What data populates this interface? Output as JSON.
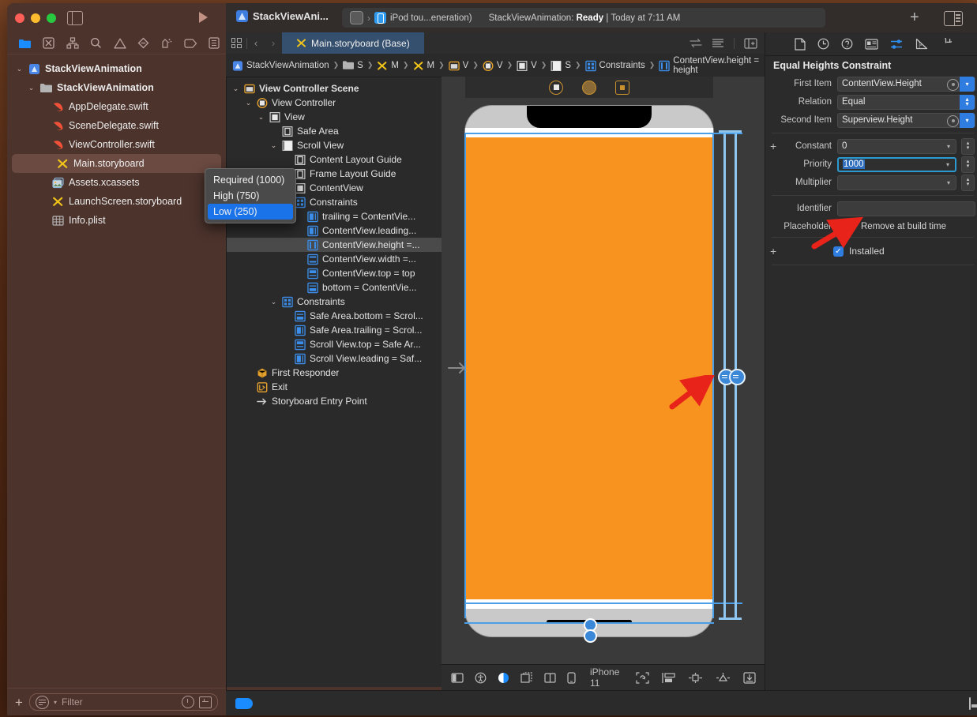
{
  "window": {
    "title": "StackViewAni...",
    "status": {
      "prefix": "StackViewAnimation:",
      "state": "Ready",
      "sep": "|",
      "time": "Today at 7:11 AM"
    },
    "device": "iPod tou...eneration)",
    "plus_label": "+"
  },
  "navigator": {
    "tabs": [
      {
        "name": "folder-icon"
      },
      {
        "name": "source-control-icon"
      },
      {
        "name": "symbol-hierarchy-icon"
      },
      {
        "name": "search-icon"
      },
      {
        "name": "issue-warning-icon"
      },
      {
        "name": "test-diamond-icon"
      },
      {
        "name": "debug-spray-icon"
      },
      {
        "name": "breakpoint-icon"
      },
      {
        "name": "report-icon"
      }
    ],
    "items": [
      {
        "label": "StackViewAnimation",
        "icon": "project-icon",
        "depth": 0,
        "disclosure": "v",
        "selected": false
      },
      {
        "label": "StackViewAnimation",
        "icon": "folder-icon",
        "depth": 1,
        "disclosure": "v",
        "selected": false
      },
      {
        "label": "AppDelegate.swift",
        "icon": "swift-icon",
        "depth": 2,
        "disclosure": "",
        "selected": false
      },
      {
        "label": "SceneDelegate.swift",
        "icon": "swift-icon",
        "depth": 2,
        "disclosure": "",
        "selected": false
      },
      {
        "label": "ViewController.swift",
        "icon": "swift-icon",
        "depth": 2,
        "disclosure": "",
        "selected": false
      },
      {
        "label": "Main.storyboard",
        "icon": "storyboard-icon",
        "depth": 2,
        "disclosure": "",
        "selected": true
      },
      {
        "label": "Assets.xcassets",
        "icon": "assets-icon",
        "depth": 2,
        "disclosure": "",
        "selected": false
      },
      {
        "label": "LaunchScreen.storyboard",
        "icon": "storyboard-icon",
        "depth": 2,
        "disclosure": "",
        "selected": false
      },
      {
        "label": "Info.plist",
        "icon": "plist-icon",
        "depth": 2,
        "disclosure": "",
        "selected": false
      }
    ],
    "filter_placeholder": "Filter"
  },
  "outline": {
    "items": [
      {
        "label": "View Controller Scene",
        "icon": "scene-icon",
        "depth": 0,
        "disclosure": "v",
        "selected": false,
        "bold": true
      },
      {
        "label": "View Controller",
        "icon": "viewcontroller-icon",
        "depth": 1,
        "disclosure": "v",
        "selected": false
      },
      {
        "label": "View",
        "icon": "view-icon",
        "depth": 2,
        "disclosure": "v",
        "selected": false
      },
      {
        "label": "Safe Area",
        "icon": "guide-icon",
        "depth": 3,
        "disclosure": "",
        "selected": false
      },
      {
        "label": "Scroll View",
        "icon": "scrollview-icon",
        "depth": 3,
        "disclosure": "v",
        "selected": false
      },
      {
        "label": "Content Layout Guide",
        "icon": "guide-icon",
        "depth": 4,
        "disclosure": "",
        "selected": false
      },
      {
        "label": "Frame Layout Guide",
        "icon": "guide-icon",
        "depth": 4,
        "disclosure": "",
        "selected": false
      },
      {
        "label": "ContentView",
        "icon": "view-icon",
        "depth": 4,
        "disclosure": "",
        "selected": false
      },
      {
        "label": "Constraints",
        "icon": "constraints-icon",
        "depth": 4,
        "disclosure": "v",
        "selected": false
      },
      {
        "label": "trailing = ContentVie...",
        "icon": "constraint-h-icon",
        "depth": 5,
        "disclosure": "",
        "selected": false
      },
      {
        "label": "ContentView.leading...",
        "icon": "constraint-h-icon",
        "depth": 5,
        "disclosure": "",
        "selected": false
      },
      {
        "label": "ContentView.height =...",
        "icon": "constraint-w-icon",
        "depth": 5,
        "disclosure": "",
        "selected": true
      },
      {
        "label": "ContentView.width =...",
        "icon": "constraint-v-icon",
        "depth": 5,
        "disclosure": "",
        "selected": false
      },
      {
        "label": "ContentView.top = top",
        "icon": "constraint-t-icon",
        "depth": 5,
        "disclosure": "",
        "selected": false
      },
      {
        "label": "bottom = ContentVie...",
        "icon": "constraint-b-icon",
        "depth": 5,
        "disclosure": "",
        "selected": false
      },
      {
        "label": "Constraints",
        "icon": "constraints-icon",
        "depth": 3,
        "disclosure": "v",
        "selected": false
      },
      {
        "label": "Safe Area.bottom = Scrol...",
        "icon": "constraint-b-icon",
        "depth": 4,
        "disclosure": "",
        "selected": false
      },
      {
        "label": "Safe Area.trailing = Scrol...",
        "icon": "constraint-h-icon",
        "depth": 4,
        "disclosure": "",
        "selected": false
      },
      {
        "label": "Scroll View.top = Safe Ar...",
        "icon": "constraint-t-icon",
        "depth": 4,
        "disclosure": "",
        "selected": false
      },
      {
        "label": "Scroll View.leading = Saf...",
        "icon": "constraint-h-icon",
        "depth": 4,
        "disclosure": "",
        "selected": false
      },
      {
        "label": "First Responder",
        "icon": "first-responder-icon",
        "depth": 1,
        "disclosure": "",
        "selected": false
      },
      {
        "label": "Exit",
        "icon": "exit-icon",
        "depth": 1,
        "disclosure": "",
        "selected": false
      },
      {
        "label": "Storyboard Entry Point",
        "icon": "entry-point-icon",
        "depth": 1,
        "disclosure": "",
        "selected": false
      }
    ],
    "filter_placeholder": "Filter"
  },
  "editor": {
    "tab_label": "Main.storyboard (Base)",
    "breadcrumb": [
      {
        "label": "StackViewAnimation",
        "icon": "project-icon"
      },
      {
        "label": "S",
        "icon": "folder-icon"
      },
      {
        "label": "M",
        "icon": "storyboard-icon"
      },
      {
        "label": "M",
        "icon": "storyboard-icon"
      },
      {
        "label": "V",
        "icon": "scene-icon"
      },
      {
        "label": "V",
        "icon": "viewcontroller-icon"
      },
      {
        "label": "V",
        "icon": "view-icon"
      },
      {
        "label": "S",
        "icon": "scrollview-icon"
      },
      {
        "label": "Constraints",
        "icon": "constraints-icon"
      },
      {
        "label": "ContentView.height = height",
        "icon": "constraint-w-icon"
      }
    ]
  },
  "canvas": {
    "device_name": "iPhone 11",
    "bottom_tools": [
      {
        "name": "show-hide-document-outline-button"
      },
      {
        "name": "accessibility-inspector-button"
      },
      {
        "name": "appearance-toggle-button"
      },
      {
        "name": "variations-button"
      },
      {
        "name": "split-layout-button"
      },
      {
        "name": "device-orientation-button"
      }
    ],
    "bottom_tools_right": [
      {
        "name": "update-frames-button"
      },
      {
        "name": "embed-in-button"
      },
      {
        "name": "align-button"
      },
      {
        "name": "add-constraints-button"
      },
      {
        "name": "resolve-auto-layout-issues-button"
      }
    ]
  },
  "inspector": {
    "tabs": [
      {
        "name": "file-inspector-icon",
        "active": false
      },
      {
        "name": "history-inspector-icon",
        "active": false
      },
      {
        "name": "quick-help-inspector-icon",
        "active": false
      },
      {
        "name": "identity-inspector-icon",
        "active": false
      },
      {
        "name": "attributes-inspector-icon",
        "active": true
      },
      {
        "name": "size-inspector-icon",
        "active": false
      },
      {
        "name": "connections-inspector-icon",
        "active": false
      }
    ],
    "title": "Equal Heights Constraint",
    "rows": [
      {
        "label": "First Item",
        "value": "ContentView.Height",
        "kind": "popup-detail"
      },
      {
        "label": "Relation",
        "value": "Equal",
        "kind": "popup"
      },
      {
        "label": "Second Item",
        "value": "Superview.Height",
        "kind": "popup-detail"
      }
    ],
    "constant": {
      "label": "Constant",
      "value": "0"
    },
    "priority": {
      "label": "Priority",
      "value": "1000"
    },
    "multiplier": {
      "label": "Multiplier",
      "value": ""
    },
    "identifier": {
      "label": "Identifier",
      "value": ""
    },
    "placeholder": {
      "label": "Placeholder",
      "value": "Remove at build time"
    },
    "installed": {
      "label": "Installed",
      "checked": true
    },
    "priority_options": [
      {
        "label": "Required (1000)",
        "active": false
      },
      {
        "label": "High (750)",
        "active": false
      },
      {
        "label": "Low (250)",
        "active": true
      }
    ]
  },
  "colors": {
    "accent_blue": "#2f7de1",
    "selection_blue": "#1a73e8",
    "content_orange": "#f7931e",
    "sidebar_brown": "#4c332c",
    "tab_blue": "#35506e",
    "constraint_blue": "#8ec6f0",
    "arrow_red": "#e8231a"
  }
}
